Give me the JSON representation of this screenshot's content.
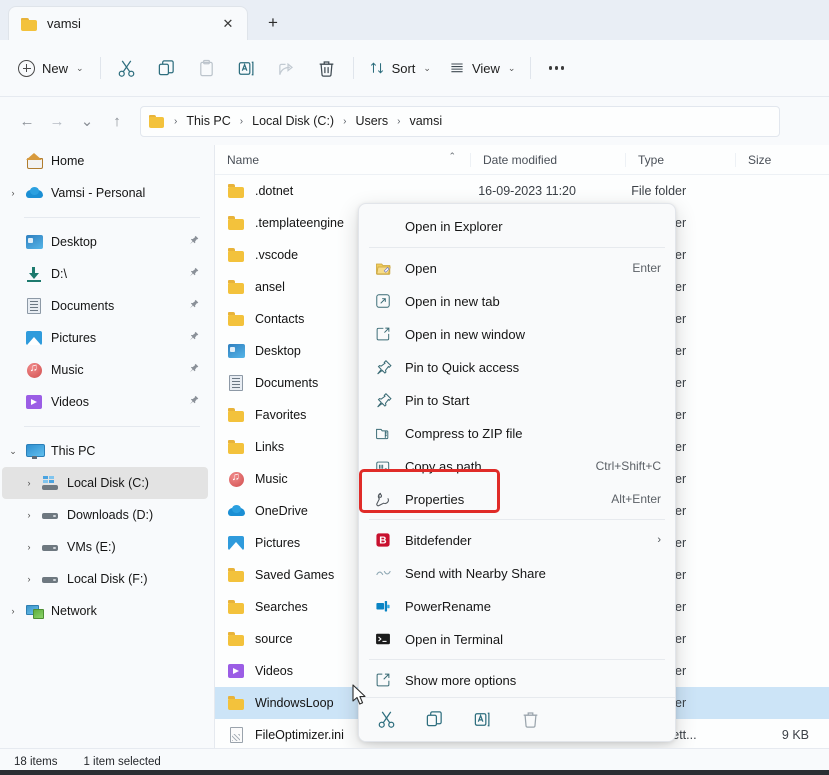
{
  "window": {
    "tab_title": "vamsi",
    "tab_close_glyph": "✕",
    "new_tab_glyph": "+"
  },
  "toolbar": {
    "new_label": "New",
    "new_chevron": "⌄",
    "cut_name": "cut-icon",
    "copy_name": "copy-icon",
    "paste_name": "paste-icon",
    "rename_name": "rename-icon",
    "share_name": "share-icon",
    "delete_name": "delete-icon",
    "sort_label": "Sort",
    "sort_chevron": "⌄",
    "view_label": "View",
    "view_chevron": "⌄",
    "more_label": "See more"
  },
  "addressbar": {
    "back_glyph": "←",
    "forward_glyph": "→",
    "recent_glyph": "⌄",
    "up_glyph": "↑",
    "separator": "›",
    "crumbs": [
      "This PC",
      "Local Disk (C:)",
      "Users",
      "vamsi"
    ]
  },
  "sidebar": {
    "items": [
      {
        "label": "Home",
        "icon": "home-icon",
        "expander": "",
        "pinned": false,
        "indent": false,
        "selected": false
      },
      {
        "label": "Vamsi - Personal",
        "icon": "onedrive-cloud-icon",
        "expander": "›",
        "pinned": false,
        "indent": false,
        "selected": false
      },
      {
        "separator": true
      },
      {
        "label": "Desktop",
        "icon": "desktop-icon",
        "expander": "",
        "pinned": true,
        "indent": false,
        "selected": false
      },
      {
        "label": "D:\\",
        "icon": "downloads-icon",
        "expander": "",
        "pinned": true,
        "indent": false,
        "selected": false
      },
      {
        "label": "Documents",
        "icon": "documents-icon",
        "expander": "",
        "pinned": true,
        "indent": false,
        "selected": false
      },
      {
        "label": "Pictures",
        "icon": "pictures-icon",
        "expander": "",
        "pinned": true,
        "indent": false,
        "selected": false
      },
      {
        "label": "Music",
        "icon": "music-icon",
        "expander": "",
        "pinned": true,
        "indent": false,
        "selected": false
      },
      {
        "label": "Videos",
        "icon": "videos-icon",
        "expander": "",
        "pinned": true,
        "indent": false,
        "selected": false
      },
      {
        "separator": true
      },
      {
        "label": "This PC",
        "icon": "this-pc-icon",
        "expander": "⌄",
        "pinned": false,
        "indent": false,
        "selected": false
      },
      {
        "label": "Local Disk (C:)",
        "icon": "windows-drive-icon",
        "expander": "›",
        "pinned": false,
        "indent": true,
        "selected": true
      },
      {
        "label": "Downloads (D:)",
        "icon": "hard-drive-icon",
        "expander": "›",
        "pinned": false,
        "indent": true,
        "selected": false
      },
      {
        "label": "VMs (E:)",
        "icon": "hard-drive-icon",
        "expander": "›",
        "pinned": false,
        "indent": true,
        "selected": false
      },
      {
        "label": "Local Disk (F:)",
        "icon": "hard-drive-icon",
        "expander": "›",
        "pinned": false,
        "indent": true,
        "selected": false
      },
      {
        "label": "Network",
        "icon": "network-icon",
        "expander": "›",
        "pinned": false,
        "indent": false,
        "selected": false
      }
    ],
    "pin_glyph": "📌"
  },
  "filelist": {
    "columns": {
      "name": "Name",
      "date_modified": "Date modified",
      "type": "Type",
      "size": "Size"
    },
    "sort_caret": "⌃",
    "rows": [
      {
        "name": ".dotnet",
        "icon": "folder-icon",
        "date": "16-09-2023 11:20",
        "type": "File folder",
        "size": "",
        "selected": false
      },
      {
        "name": ".templateengine",
        "icon": "folder-icon",
        "date": "",
        "type": "File folder",
        "size": "",
        "selected": false
      },
      {
        "name": ".vscode",
        "icon": "folder-icon",
        "date": "",
        "type": "File folder",
        "size": "",
        "selected": false
      },
      {
        "name": "ansel",
        "icon": "folder-icon",
        "date": "",
        "type": "File folder",
        "size": "",
        "selected": false
      },
      {
        "name": "Contacts",
        "icon": "folder-icon",
        "date": "",
        "type": "File folder",
        "size": "",
        "selected": false
      },
      {
        "name": "Desktop",
        "icon": "desktop-icon",
        "date": "",
        "type": "File folder",
        "size": "",
        "selected": false
      },
      {
        "name": "Documents",
        "icon": "documents-icon",
        "date": "",
        "type": "File folder",
        "size": "",
        "selected": false
      },
      {
        "name": "Favorites",
        "icon": "folder-icon",
        "date": "",
        "type": "File folder",
        "size": "",
        "selected": false
      },
      {
        "name": "Links",
        "icon": "folder-icon",
        "date": "",
        "type": "File folder",
        "size": "",
        "selected": false
      },
      {
        "name": "Music",
        "icon": "music-icon",
        "date": "",
        "type": "File folder",
        "size": "",
        "selected": false
      },
      {
        "name": "OneDrive",
        "icon": "onedrive-cloud-icon",
        "date": "",
        "type": "File folder",
        "size": "",
        "selected": false
      },
      {
        "name": "Pictures",
        "icon": "pictures-icon",
        "date": "",
        "type": "File folder",
        "size": "",
        "selected": false
      },
      {
        "name": "Saved Games",
        "icon": "folder-icon",
        "date": "",
        "type": "File folder",
        "size": "",
        "selected": false
      },
      {
        "name": "Searches",
        "icon": "folder-icon",
        "date": "",
        "type": "File folder",
        "size": "",
        "selected": false
      },
      {
        "name": "source",
        "icon": "folder-icon",
        "date": "",
        "type": "File folder",
        "size": "",
        "selected": false
      },
      {
        "name": "Videos",
        "icon": "videos-icon",
        "date": "",
        "type": "File folder",
        "size": "",
        "selected": false
      },
      {
        "name": "WindowsLoop",
        "icon": "folder-icon",
        "date": "",
        "type": "File folder",
        "size": "",
        "selected": true
      },
      {
        "name": "FileOptimizer.ini",
        "icon": "ini-file-icon",
        "date": "",
        "type": "ration sett...",
        "size": "9 KB",
        "selected": false
      }
    ]
  },
  "context_menu": {
    "header_item": "Open in Explorer",
    "items": [
      {
        "label": "Open",
        "icon": "open-folder-icon",
        "accel": "Enter",
        "submenu": false,
        "highlighted": false
      },
      {
        "label": "Open in new tab",
        "icon": "new-tab-icon",
        "accel": "",
        "submenu": false,
        "highlighted": false
      },
      {
        "label": "Open in new window",
        "icon": "new-window-icon",
        "accel": "",
        "submenu": false,
        "highlighted": false
      },
      {
        "label": "Pin to Quick access",
        "icon": "pin-icon",
        "accel": "",
        "submenu": false,
        "highlighted": false
      },
      {
        "label": "Pin to Start",
        "icon": "pin-icon",
        "accel": "",
        "submenu": false,
        "highlighted": false
      },
      {
        "label": "Compress to ZIP file",
        "icon": "zip-icon",
        "accel": "",
        "submenu": false,
        "highlighted": false
      },
      {
        "label": "Copy as path",
        "icon": "copy-path-icon",
        "accel": "Ctrl+Shift+C",
        "submenu": false,
        "highlighted": false
      },
      {
        "label": "Properties",
        "icon": "wrench-icon",
        "accel": "Alt+Enter",
        "submenu": false,
        "highlighted": true
      }
    ],
    "items2": [
      {
        "label": "Bitdefender",
        "icon": "bitdefender-icon",
        "accel": "",
        "submenu": true,
        "highlighted": false
      },
      {
        "label": "Send with Nearby Share",
        "icon": "nearby-share-icon",
        "accel": "",
        "submenu": false,
        "highlighted": false
      },
      {
        "label": "PowerRename",
        "icon": "powerrename-icon",
        "accel": "",
        "submenu": false,
        "highlighted": false
      },
      {
        "label": "Open in Terminal",
        "icon": "terminal-icon",
        "accel": "",
        "submenu": false,
        "highlighted": false
      }
    ],
    "items3": [
      {
        "label": "Show more options",
        "icon": "show-more-icon",
        "accel": "",
        "submenu": false,
        "highlighted": false
      }
    ],
    "submenu_glyph": "›",
    "iconrow": [
      "cut-icon",
      "copy-icon",
      "rename-icon",
      "delete-icon"
    ],
    "highlight_color": "#e02b28"
  },
  "statusbar": {
    "item_count": "18 items",
    "selection": "1 item selected"
  }
}
